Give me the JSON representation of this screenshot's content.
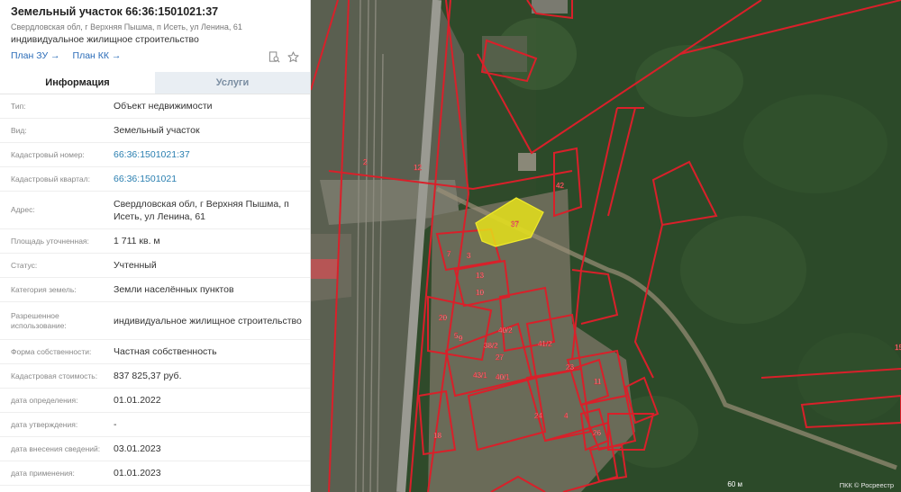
{
  "header": {
    "title": "Земельный участок 66:36:1501021:37",
    "address": "Свердловская обл, г Верхняя Пышма, п Исеть, ул Ленина, 61",
    "usage": "индивидуальное жилищное строительство",
    "link_plan_zu": "План ЗУ →",
    "link_plan_kk": "План КК →",
    "icons": [
      "search-document-icon",
      "star-icon"
    ]
  },
  "tabs": {
    "info": "Информация",
    "services": "Услуги"
  },
  "fields": [
    {
      "label": "Тип:",
      "value": "Объект недвижимости"
    },
    {
      "label": "Вид:",
      "value": "Земельный участок"
    },
    {
      "label": "Кадастровый номер:",
      "value": "66:36:1501021:37"
    },
    {
      "label": "Кадастровый квартал:",
      "value": "66:36:1501021"
    },
    {
      "label": "Адрес:",
      "value": "Свердловская обл, г Верхняя Пышма, п Исеть, ул Ленина, 61"
    },
    {
      "label": "Площадь уточненная:",
      "value": "1 711 кв. м"
    },
    {
      "label": "Статус:",
      "value": "Учтенный"
    },
    {
      "label": "Категория земель:",
      "value": "Земли населённых пунктов"
    },
    {
      "label": "Разрешенное использование:",
      "value": "индивидуальное жилищное строительство"
    },
    {
      "label": "Форма собственности:",
      "value": "Частная собственность"
    },
    {
      "label": "Кадастровая стоимость:",
      "value": "837 825,37 руб."
    },
    {
      "label": "дата определения:",
      "value": "01.01.2022"
    },
    {
      "label": "дата утверждения:",
      "value": "-"
    },
    {
      "label": "дата внесения сведений:",
      "value": "03.01.2023"
    },
    {
      "label": "дата применения:",
      "value": "01.01.2023"
    }
  ],
  "map": {
    "parcel_labels": [
      "37",
      "2",
      "12",
      "42",
      "7",
      "3",
      "13",
      "20",
      "9",
      "23",
      "27",
      "40/2",
      "41/2",
      "18",
      "26",
      "11",
      "5",
      "4",
      "24",
      "38/2",
      "43/1",
      "40/1",
      "15",
      "10"
    ],
    "selected_parcel_label": "37",
    "scale_label": "60 м",
    "copyright": "ПКК © Росреестр",
    "colors": {
      "parcel_border": "#d9202a",
      "selected_fill": "#e6e21a",
      "forest": "#2e4a28"
    }
  }
}
